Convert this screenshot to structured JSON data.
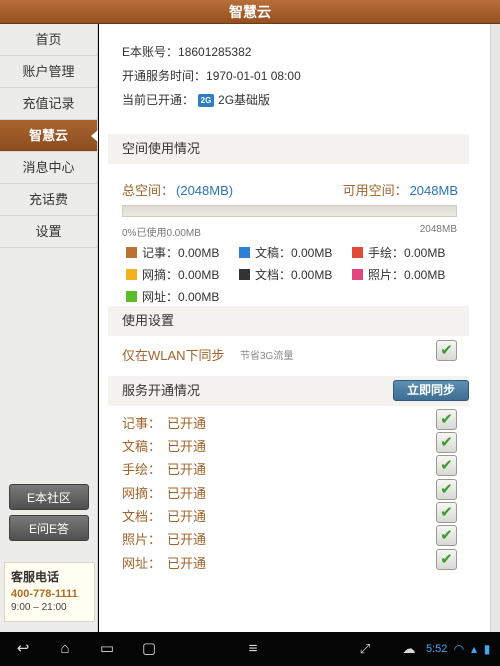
{
  "app": {
    "title": "智慧云"
  },
  "sidebar": {
    "items": [
      {
        "label": "首页"
      },
      {
        "label": "账户管理"
      },
      {
        "label": "充值记录"
      },
      {
        "label": "智慧云"
      },
      {
        "label": "消息中心"
      },
      {
        "label": "充话费"
      },
      {
        "label": "设置"
      }
    ],
    "active_index": 3,
    "community_button": "E本社区",
    "qa_button": "E问E答",
    "hotline": {
      "label": "客服电话",
      "number": "400-778-1111",
      "hours": "9:00 – 21:00"
    }
  },
  "account": {
    "account_label": "E本账号：",
    "account_value": "18601285382",
    "open_time_label": "开通服务时间：",
    "open_time_value": "1970-01-01 08:00",
    "current_label": "当前已开通：",
    "plan_icon": "2G",
    "plan_value": "2G基础版"
  },
  "space": {
    "section_title": "空间使用情况",
    "total_label": "总空间：",
    "total_value": "(2048MB)",
    "available_label": "可用空间：",
    "available_value": "2048MB",
    "used_fraction": 0,
    "usage_left_text": "0%已使用0.00MB",
    "usage_right_text": "2048MB",
    "legend": [
      {
        "label": "记事：0.00MB",
        "color": "#b87333"
      },
      {
        "label": "文稿：0.00MB",
        "color": "#2f7fd6"
      },
      {
        "label": "手绘：0.00MB",
        "color": "#e04b37"
      },
      {
        "label": "网摘：0.00MB",
        "color": "#f2b21c"
      },
      {
        "label": "文档：0.00MB",
        "color": "#333333"
      },
      {
        "label": "照片：0.00MB",
        "color": "#e0457f"
      },
      {
        "label": "网址：0.00MB",
        "color": "#5bbd2b"
      }
    ]
  },
  "settings": {
    "section_title": "使用设置",
    "wlan_label": "仅在WLAN下同步",
    "wlan_hint": "节省3G流量",
    "wlan_checked": true
  },
  "services": {
    "section_title": "服务开通情况",
    "sync_button": "立即同步",
    "rows": [
      {
        "name": "记事：",
        "status": "已开通",
        "checked": true
      },
      {
        "name": "文稿：",
        "status": "已开通",
        "checked": true
      },
      {
        "name": "手绘：",
        "status": "已开通",
        "checked": true
      },
      {
        "name": "网摘：",
        "status": "已开通",
        "checked": true
      },
      {
        "name": "文档：",
        "status": "已开通",
        "checked": true
      },
      {
        "name": "照片：",
        "status": "已开通",
        "checked": true
      },
      {
        "name": "网址：",
        "status": "已开通",
        "checked": true
      }
    ]
  },
  "system_bar": {
    "time": "5:52",
    "icons": [
      "back-icon",
      "home-icon",
      "recents-icon",
      "screenshot-icon",
      "menu-icon",
      "fullscreen-icon",
      "cloud-icon",
      "wifi-icon",
      "battery-icon"
    ]
  }
}
